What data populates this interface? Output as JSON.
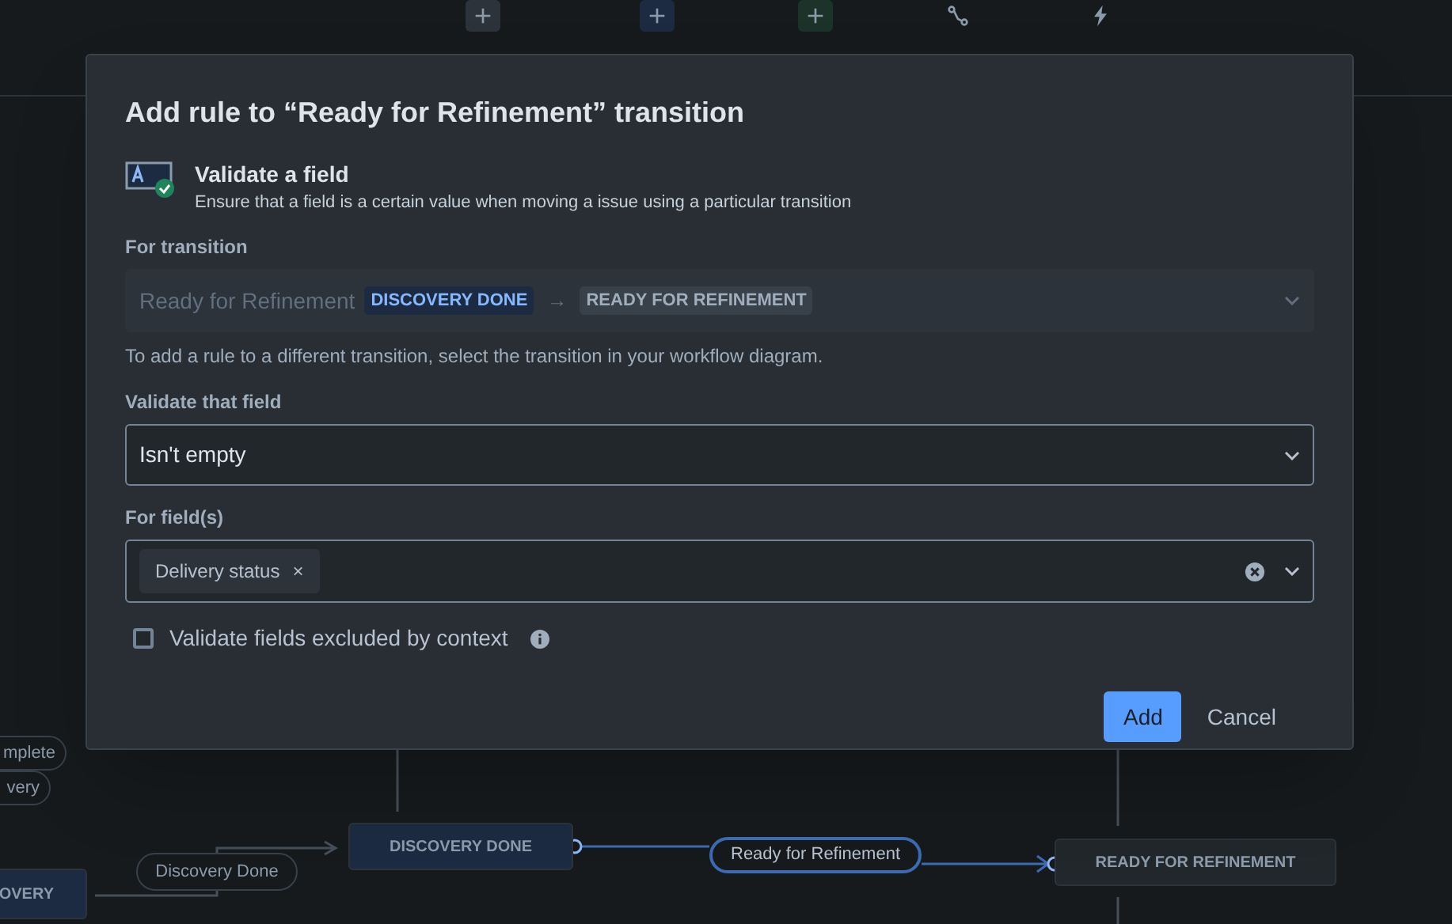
{
  "toolbar": {
    "items": [
      {
        "kind": "add",
        "color": "#2c333a"
      },
      {
        "kind": "add",
        "color": "#1c2b41"
      },
      {
        "kind": "add",
        "color": "#1c3329"
      },
      {
        "kind": "transition",
        "color": "#161a1d"
      },
      {
        "kind": "rule",
        "color": "#161a1d"
      }
    ]
  },
  "diagram": {
    "nodes": [
      {
        "kind": "transition",
        "label": "mplete",
        "selected": false
      },
      {
        "kind": "transition",
        "label": "very",
        "selected": false
      },
      {
        "kind": "status",
        "label": "OVERY",
        "color": "#1c2b41"
      },
      {
        "kind": "transition",
        "label": "Discovery Done",
        "selected": false
      },
      {
        "kind": "status",
        "label": "DISCOVERY DONE",
        "color": "#1c2b41"
      },
      {
        "kind": "transition",
        "label": "Ready for Refinement",
        "selected": true
      },
      {
        "kind": "status",
        "label": "READY FOR REFINEMENT",
        "color": "#22272b"
      }
    ]
  },
  "dialog": {
    "title": "Add rule to “Ready for Refinement” transition",
    "rule": {
      "name": "Validate a field",
      "description": "Ensure that a field is a certain value when moving a issue using a particular transition"
    },
    "for_transition": {
      "label": "For transition",
      "disabled": true,
      "value": "Ready for Refinement",
      "from": "DISCOVERY DONE",
      "arrow": "→",
      "to": "READY FOR REFINEMENT",
      "help": "To add a rule to a different transition, select the transition in your workflow diagram."
    },
    "validate_that_field": {
      "label": "Validate that field",
      "value": "Isn't empty"
    },
    "for_fields": {
      "label": "For field(s)",
      "tags": [
        {
          "label": "Delivery status",
          "remove": "×"
        }
      ]
    },
    "checkbox": {
      "label": "Validate fields excluded by context",
      "checked": false
    },
    "buttons": [
      {
        "label": "Add",
        "kind": "primary"
      },
      {
        "label": "Cancel",
        "kind": "subtle"
      }
    ]
  }
}
